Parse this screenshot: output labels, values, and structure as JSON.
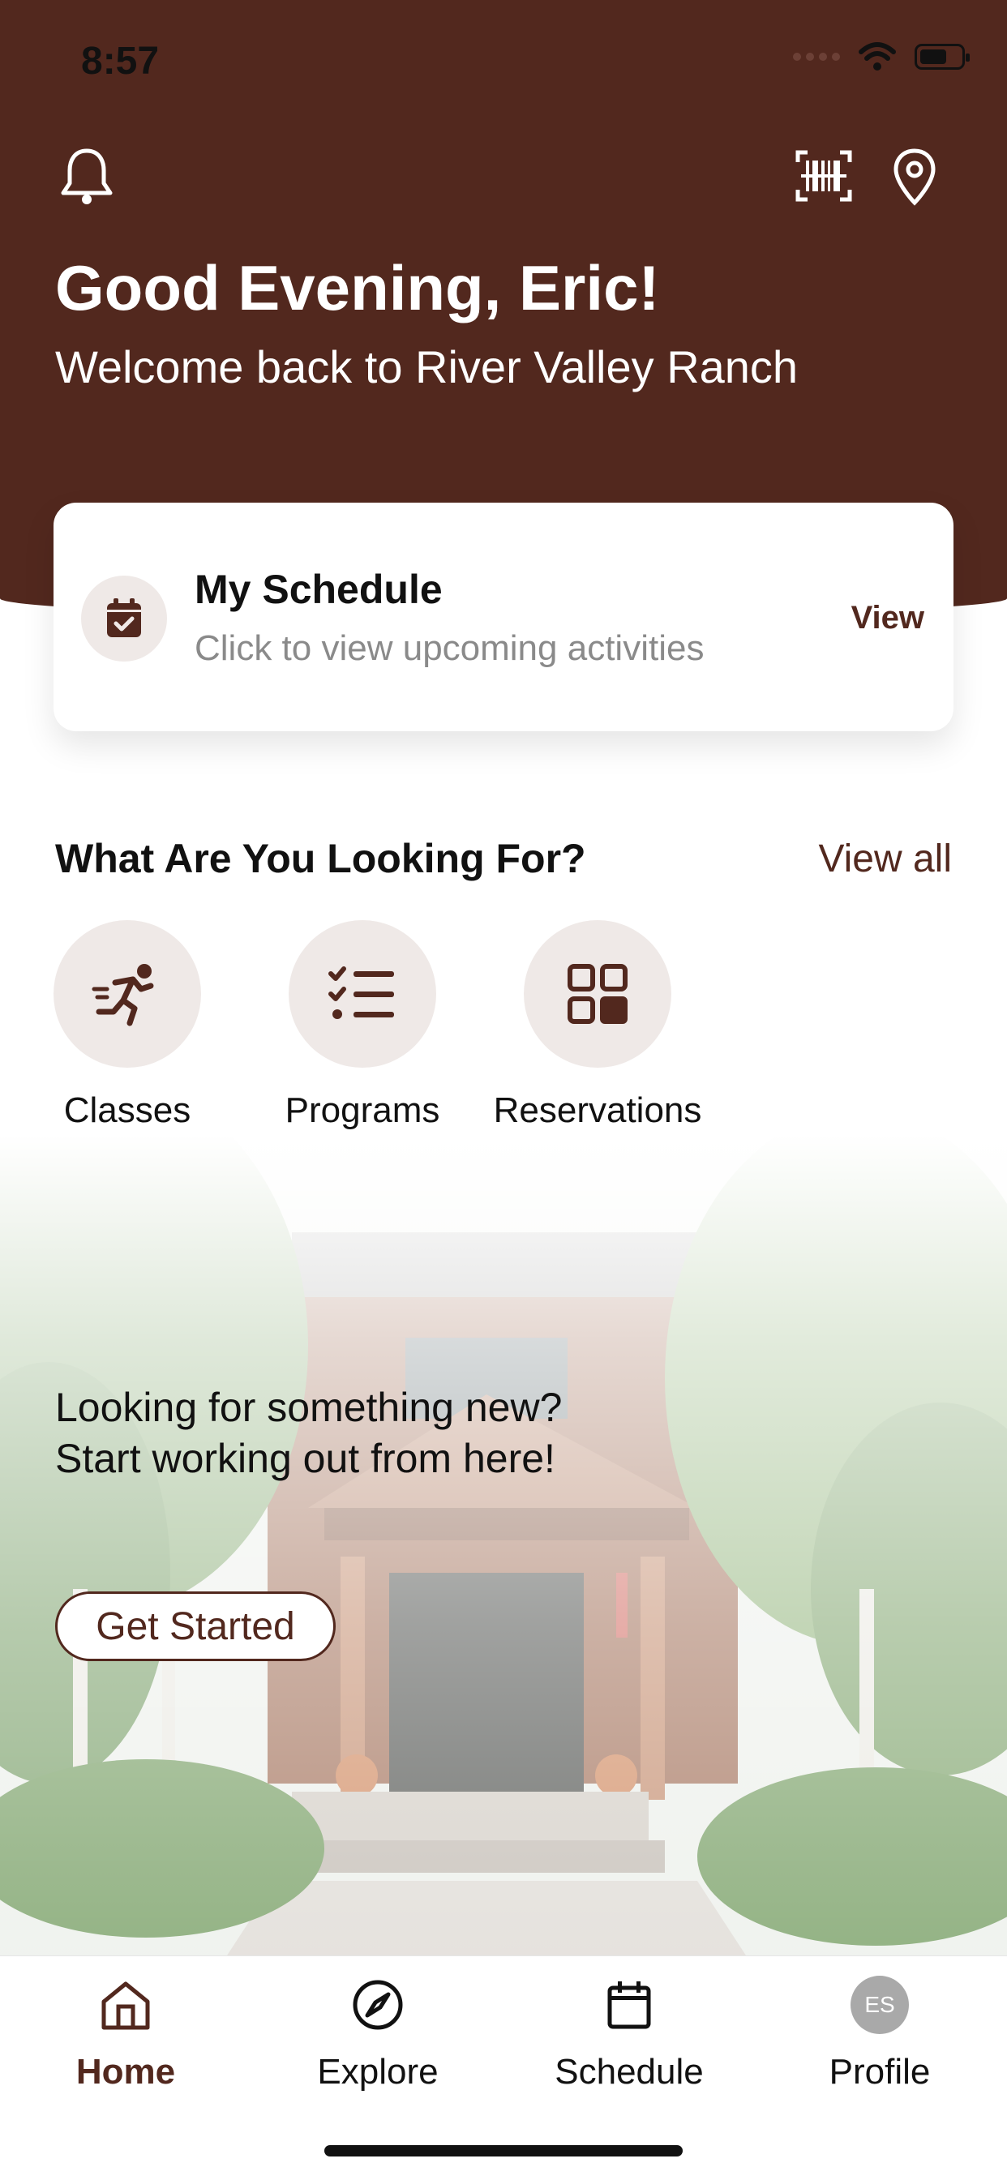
{
  "status_bar": {
    "time": "8:57"
  },
  "header": {
    "greeting": "Good Evening, Eric!",
    "welcome": "Welcome back to River Valley Ranch"
  },
  "schedule_card": {
    "title": "My Schedule",
    "subtitle": "Click to view upcoming activities",
    "action": "View"
  },
  "categories": {
    "title": "What Are You Looking For?",
    "view_all": "View all",
    "items": [
      {
        "label": "Classes",
        "icon": "running-person-icon"
      },
      {
        "label": "Programs",
        "icon": "checklist-icon"
      },
      {
        "label": "Reservations",
        "icon": "grid-icon"
      }
    ]
  },
  "hero": {
    "line1": "Looking for something new?",
    "line2": "Start working out from here!",
    "button": "Get Started"
  },
  "tabbar": {
    "items": [
      {
        "label": "Home",
        "icon": "home-icon",
        "active": true
      },
      {
        "label": "Explore",
        "icon": "compass-icon",
        "active": false
      },
      {
        "label": "Schedule",
        "icon": "calendar-icon",
        "active": false
      },
      {
        "label": "Profile",
        "icon": "avatar",
        "active": false
      }
    ],
    "avatar_initials": "ES"
  },
  "colors": {
    "brand": "#52281e",
    "chip_bg": "#efe9e7",
    "muted_text": "#8a8a8a"
  }
}
